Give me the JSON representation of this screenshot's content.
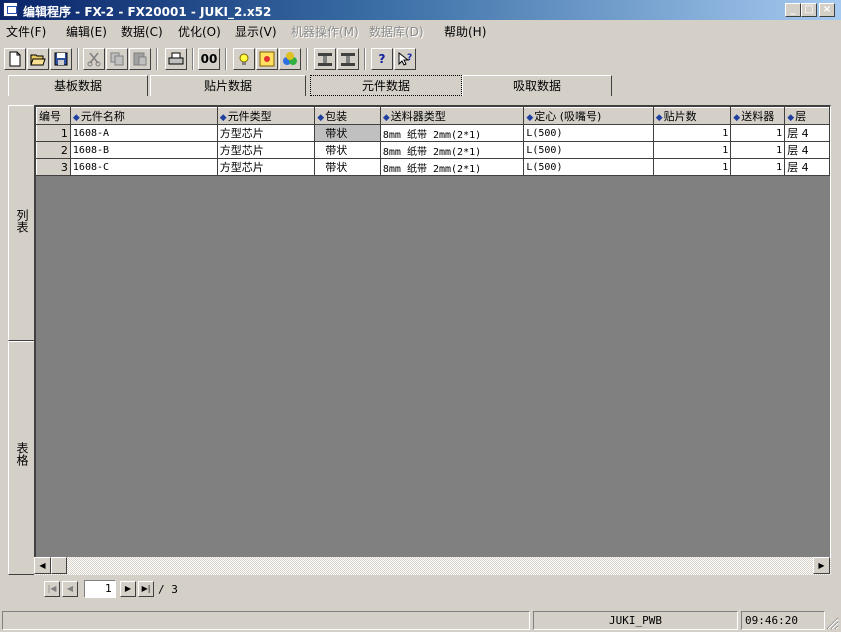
{
  "window": {
    "title": "编辑程序  -  FX-2  -  FX20001  -  JUKI_2.x52",
    "min_label": "_",
    "max_label": "□",
    "close_label": "×"
  },
  "menu": [
    {
      "label": "文件(F)",
      "enabled": true
    },
    {
      "label": "编辑(E)",
      "enabled": true
    },
    {
      "label": "数据(C)",
      "enabled": true
    },
    {
      "label": "优化(O)",
      "enabled": true
    },
    {
      "label": "显示(V)",
      "enabled": true
    },
    {
      "label": "机器操作(M)",
      "enabled": false
    },
    {
      "label": "数据库(D)",
      "enabled": false
    },
    {
      "label": "帮助(H)",
      "enabled": true
    }
  ],
  "toolbar": {
    "icons": [
      "new-file-icon",
      "open-folder-icon",
      "save-icon",
      "cut-icon",
      "copy-icon",
      "paste-icon",
      "print-icon",
      "find-icon",
      "idea-icon",
      "optimize-icon",
      "group-icon",
      "align-left-icon",
      "align-right-icon",
      "help-icon",
      "context-help-icon"
    ],
    "glyph_00": "00"
  },
  "tabs": [
    {
      "label": "基板数据"
    },
    {
      "label": "贴片数据"
    },
    {
      "label": "元件数据",
      "active": true
    },
    {
      "label": "吸取数据"
    }
  ],
  "side_tabs": {
    "list": "列表",
    "table": "表格"
  },
  "grid": {
    "columns": [
      "编号",
      "元件名称",
      "元件类型",
      "包装",
      "送料器类型",
      "定心 (吸嘴号)",
      "贴片数",
      "送料器",
      "层"
    ],
    "rows": [
      {
        "no": "1",
        "name": "1608-A",
        "type": "方型芯片",
        "package": "带状",
        "feeder_type": "8mm 纸带  2mm(2*1)",
        "centering": "L(500)",
        "count": "1",
        "feeders": "1",
        "layer": "层 4"
      },
      {
        "no": "2",
        "name": "1608-B",
        "type": "方型芯片",
        "package": "带状",
        "feeder_type": "8mm 纸带  2mm(2*1)",
        "centering": "L(500)",
        "count": "1",
        "feeders": "1",
        "layer": "层 4"
      },
      {
        "no": "3",
        "name": "1608-C",
        "type": "方型芯片",
        "package": "带状",
        "feeder_type": "8mm 纸带  2mm(2*1)",
        "centering": "L(500)",
        "count": "1",
        "feeders": "1",
        "layer": "层 4"
      }
    ]
  },
  "pager": {
    "current": "1",
    "total_text": "/ 3"
  },
  "status": {
    "panel_label": "JUKI_PWB",
    "time": "09:46:20"
  },
  "colors": {
    "title_start": "#0a246a",
    "title_end": "#a6caf0",
    "face": "#d4d0c8"
  }
}
